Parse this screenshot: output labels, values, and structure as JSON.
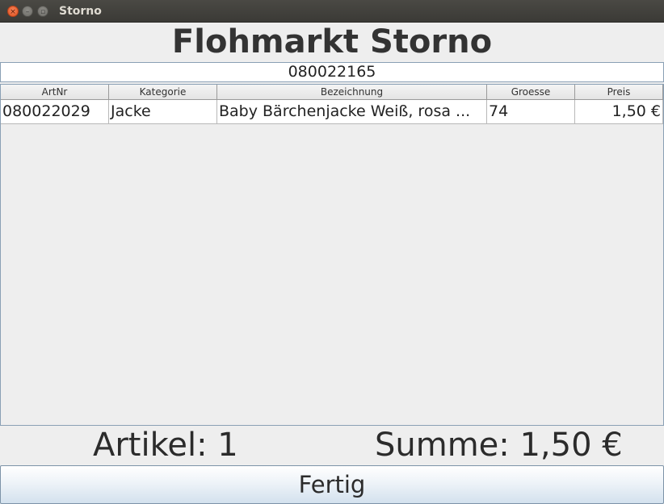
{
  "window": {
    "title": "Storno"
  },
  "heading": "Flohmarkt Storno",
  "scan_field": {
    "value": "080022165"
  },
  "table": {
    "columns": [
      "ArtNr",
      "Kategorie",
      "Bezeichnung",
      "Groesse",
      "Preis"
    ],
    "rows": [
      [
        "080022029",
        "Jacke",
        "Baby Bärchenjacke Weiß, rosa ...",
        "74",
        "1,50 €"
      ]
    ]
  },
  "stats": {
    "articles": "Artikel: 1",
    "sum": "Summe: 1,50 €"
  },
  "buttons": {
    "done": "Fertig"
  },
  "icons": {
    "close": "close-icon",
    "minimize": "minimize-icon",
    "maximize": "maximize-icon"
  }
}
